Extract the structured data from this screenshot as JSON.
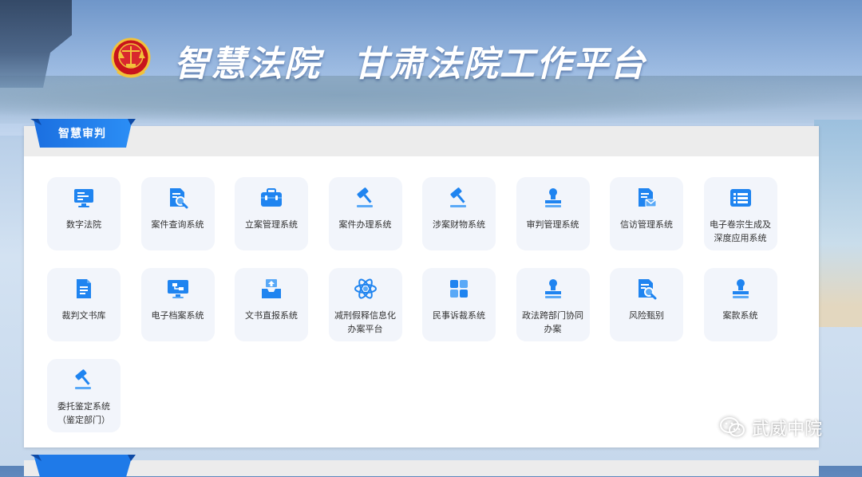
{
  "header": {
    "title_part1": "智慧法院",
    "title_part2": "甘肃法院工作平台"
  },
  "section": {
    "title": "智慧审判"
  },
  "apps": [
    {
      "label": "数字法院",
      "icon": "monitor-icon"
    },
    {
      "label": "案件查询系统",
      "icon": "document-search-icon"
    },
    {
      "label": "立案管理系统",
      "icon": "toolbox-icon"
    },
    {
      "label": "案件办理系统",
      "icon": "gavel-icon"
    },
    {
      "label": "涉案财物系统",
      "icon": "gavel-icon"
    },
    {
      "label": "审判管理系统",
      "icon": "stamp-icon"
    },
    {
      "label": "信访管理系统",
      "icon": "document-mail-icon"
    },
    {
      "label": "电子卷宗生成及\n深度应用系统",
      "icon": "list-card-icon"
    },
    {
      "label": "裁判文书库",
      "icon": "document-icon"
    },
    {
      "label": "电子档案系统",
      "icon": "network-monitor-icon"
    },
    {
      "label": "文书直报系统",
      "icon": "inbox-upload-icon"
    },
    {
      "label": "减刑假释信息化\n办案平台",
      "icon": "atom-icon"
    },
    {
      "label": "民事诉裁系统",
      "icon": "grid-icon"
    },
    {
      "label": "政法跨部门协同\n办案",
      "icon": "stamp-icon"
    },
    {
      "label": "风险甄别",
      "icon": "document-search-icon"
    },
    {
      "label": "案款系统",
      "icon": "stamp-icon"
    },
    {
      "label": "委托鉴定系统\n（鉴定部门）",
      "icon": "gavel-icon"
    }
  ],
  "watermark": {
    "text": "武威中院"
  },
  "colors": {
    "accent": "#1f84f0",
    "tile_bg": "#f2f5fb",
    "ribbon": "#1a73e8"
  }
}
